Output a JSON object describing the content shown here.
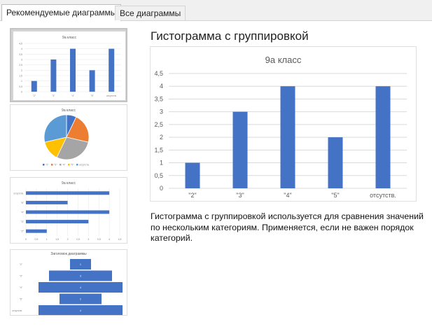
{
  "tabs": [
    {
      "label": "Рекомендуемые диаграммы",
      "active": true
    },
    {
      "label": "Все диаграммы",
      "active": false
    }
  ],
  "selected_chart": {
    "name": "Гистограмма с группировкой",
    "description": "Гистограмма с группировкой используется для сравнения значений по нескольким категориям. Применяется, если не важен порядок категорий."
  },
  "colors": {
    "bar": "#4472c4",
    "grid": "#d9d9d9",
    "axis_text": "#595959",
    "title": "#595959"
  },
  "chart_data": {
    "type": "bar",
    "title": "9а класс",
    "categories": [
      "\"2\"",
      "\"3\"",
      "\"4\"",
      "\"5\"",
      "отсутств."
    ],
    "values": [
      1,
      3,
      4,
      2,
      4
    ],
    "ylim": [
      0,
      4.5
    ],
    "yticks": [
      "0",
      "0,5",
      "1",
      "1,5",
      "2",
      "2,5",
      "3",
      "3,5",
      "4",
      "4,5"
    ],
    "grid": true
  },
  "thumbnails": [
    {
      "type": "bar",
      "title": "9а класс",
      "categories": [
        "\"2\"",
        "\"3\"",
        "\"4\"",
        "\"5\"",
        "отсутств."
      ],
      "values": [
        1,
        3,
        4,
        2,
        4
      ],
      "yticks": [
        "0",
        "0,5",
        "1",
        "1,5",
        "2",
        "2,5",
        "3",
        "3,5",
        "4",
        "4,5"
      ],
      "selected": true
    },
    {
      "type": "pie",
      "title": "9а класс",
      "values": [
        1,
        3,
        4,
        2,
        4
      ],
      "colors": [
        "#4472c4",
        "#ed7d31",
        "#a5a5a5",
        "#ffc000",
        "#5b9bd5"
      ],
      "legend": [
        "\"2\"",
        "\"3\"",
        "\"4\"",
        "\"5\"",
        "отсутств."
      ]
    },
    {
      "type": "barh",
      "title": "9а класс",
      "categories": [
        "отсутств.",
        "\"5\"",
        "\"4\"",
        "\"3\"",
        "\"2\""
      ],
      "values": [
        4,
        2,
        4,
        3,
        1
      ],
      "xticks": [
        "0",
        "0,5",
        "1",
        "1,5",
        "2",
        "2,5",
        "3",
        "3,5",
        "4",
        "4,5"
      ]
    },
    {
      "type": "funnel",
      "title": "Заголовок диаграммы",
      "categories": [
        "\"2\"",
        "\"3\"",
        "\"4\"",
        "\"5\"",
        "отсутств."
      ],
      "values": [
        1,
        3,
        4,
        2,
        4
      ]
    }
  ]
}
